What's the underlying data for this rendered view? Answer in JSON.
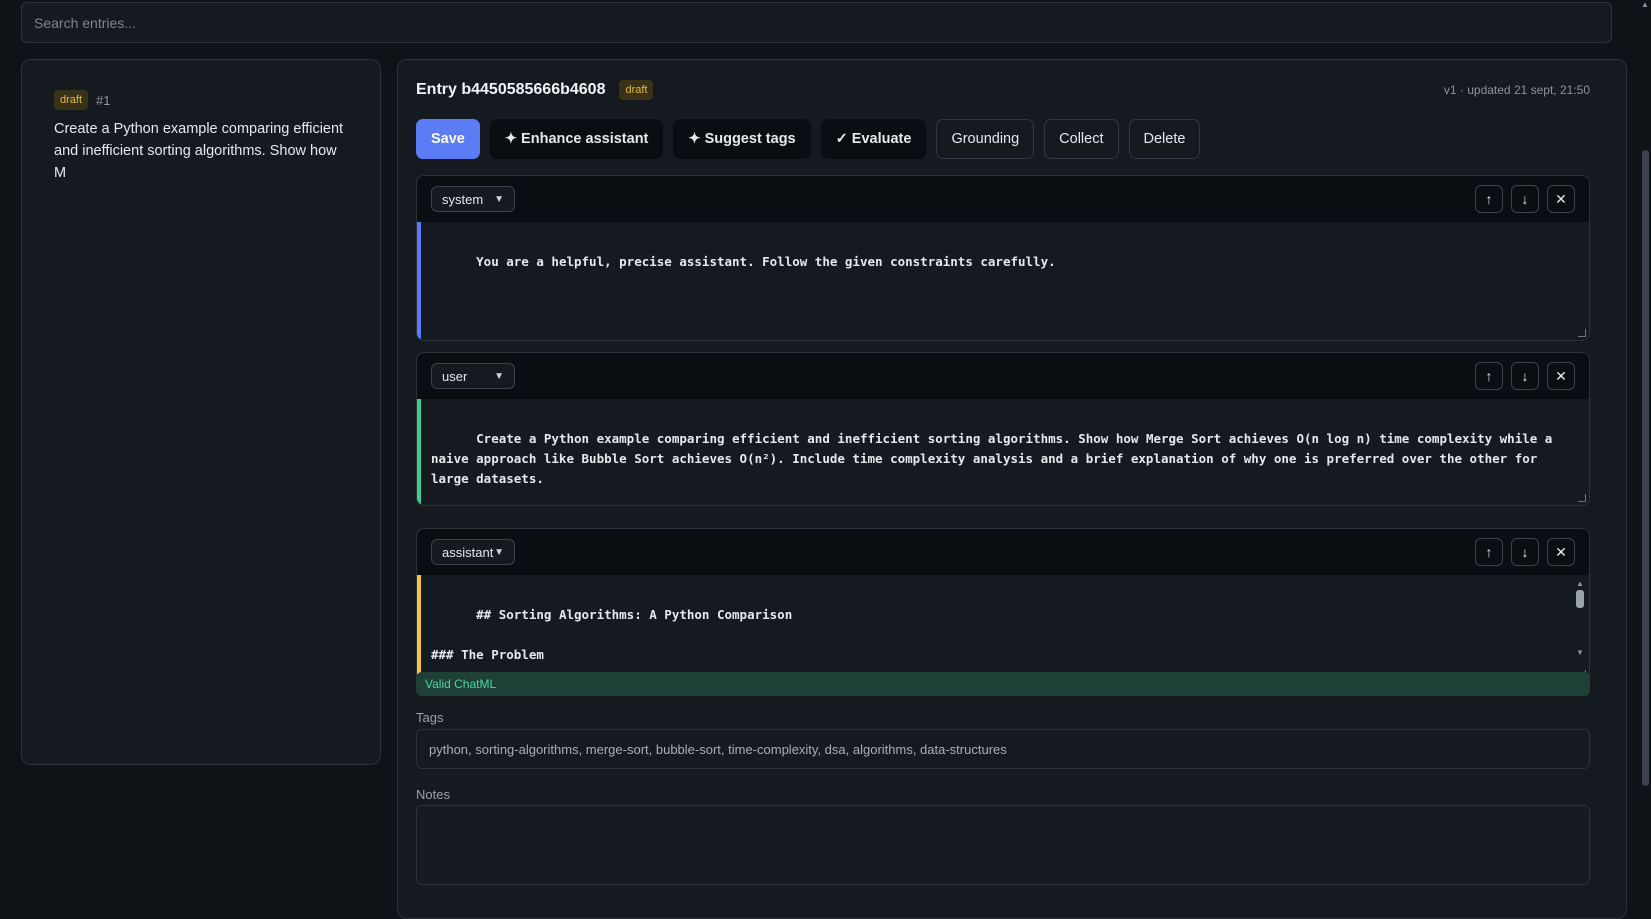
{
  "search": {
    "placeholder": "Search entries..."
  },
  "list": {
    "items": [
      {
        "status": "draft",
        "number": "#1",
        "snippet": "Create a Python example comparing efficient and inefficient sorting algorithms. Show how M"
      }
    ]
  },
  "entry": {
    "title": "Entry b4450585666b4608",
    "status": "draft",
    "updated": "v1 · updated 21 sept, 21:50"
  },
  "toolbar": {
    "save": "Save",
    "enhance": "✦ Enhance assistant",
    "suggest_tags": "✦ Suggest tags",
    "evaluate": "✓ Evaluate",
    "grounding": "Grounding",
    "collect": "Collect",
    "delete": "Delete"
  },
  "messages": [
    {
      "role": "system",
      "color": "#5b7cf5",
      "content": "You are a helpful, precise assistant. Follow the given constraints carefully."
    },
    {
      "role": "user",
      "color": "#3ecf8e",
      "content": "Create a Python example comparing efficient and inefficient sorting algorithms. Show how Merge Sort achieves O(n log n) time complexity while a naive approach like Bubble Sort achieves O(n²). Include time complexity analysis and a brief explanation of why one is preferred over the other for large datasets."
    },
    {
      "role": "assistant",
      "color": "#f5c542",
      "content": "## Sorting Algorithms: A Python Comparison\n\n### The Problem\n\nSorting is a fundamental operation in computing. The efficiency of a sorting algorithm matters enormously—as datasets grow from thousands to"
    }
  ],
  "controls": {
    "up": "↑",
    "down": "↓",
    "remove": "✕"
  },
  "validation": {
    "text": "Valid ChatML"
  },
  "tags": {
    "label": "Tags",
    "value": "python, sorting-algorithms, merge-sort, bubble-sort, time-complexity, dsa, algorithms, data-structures"
  },
  "notes": {
    "label": "Notes",
    "value": ""
  }
}
